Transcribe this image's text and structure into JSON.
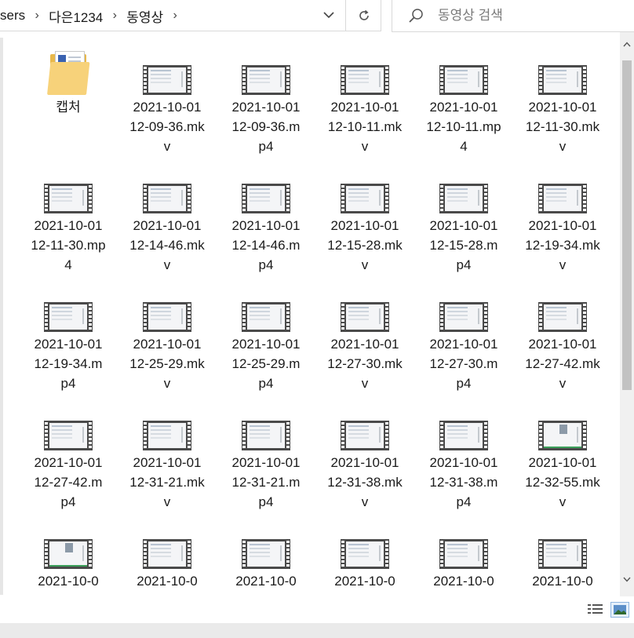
{
  "address": {
    "crumbs": [
      "sers",
      "다은1234",
      "동영상"
    ],
    "separator": "›"
  },
  "search": {
    "placeholder": "동영상 검색",
    "value": ""
  },
  "items": [
    {
      "name": "캡처",
      "type": "folder"
    },
    {
      "name": "2021-10-01 12-09-36.mkv",
      "type": "video"
    },
    {
      "name": "2021-10-01 12-09-36.mp4",
      "type": "video"
    },
    {
      "name": "2021-10-01 12-10-11.mkv",
      "type": "video"
    },
    {
      "name": "2021-10-01 12-10-11.mp4",
      "type": "video"
    },
    {
      "name": "2021-10-01 12-11-30.mkv",
      "type": "video"
    },
    {
      "name": "2021-10-01 12-11-30.mp4",
      "type": "video"
    },
    {
      "name": "2021-10-01 12-14-46.mkv",
      "type": "video"
    },
    {
      "name": "2021-10-01 12-14-46.mp4",
      "type": "video"
    },
    {
      "name": "2021-10-01 12-15-28.mkv",
      "type": "video"
    },
    {
      "name": "2021-10-01 12-15-28.mp4",
      "type": "video"
    },
    {
      "name": "2021-10-01 12-19-34.mkv",
      "type": "video"
    },
    {
      "name": "2021-10-01 12-19-34.mp4",
      "type": "video"
    },
    {
      "name": "2021-10-01 12-25-29.mkv",
      "type": "video"
    },
    {
      "name": "2021-10-01 12-25-29.mp4",
      "type": "video"
    },
    {
      "name": "2021-10-01 12-27-30.mkv",
      "type": "video"
    },
    {
      "name": "2021-10-01 12-27-30.mp4",
      "type": "video"
    },
    {
      "name": "2021-10-01 12-27-42.mkv",
      "type": "video"
    },
    {
      "name": "2021-10-01 12-27-42.mp4",
      "type": "video"
    },
    {
      "name": "2021-10-01 12-31-21.mkv",
      "type": "video"
    },
    {
      "name": "2021-10-01 12-31-21.mp4",
      "type": "video"
    },
    {
      "name": "2021-10-01 12-31-38.mkv",
      "type": "video"
    },
    {
      "name": "2021-10-01 12-31-38.mp4",
      "type": "video"
    },
    {
      "name": "2021-10-01 12-32-55.mkv",
      "type": "video",
      "thumb": "person"
    },
    {
      "name": "2021-10-0",
      "type": "video",
      "thumb": "person"
    },
    {
      "name": "2021-10-0",
      "type": "video"
    },
    {
      "name": "2021-10-0",
      "type": "video"
    },
    {
      "name": "2021-10-0",
      "type": "video"
    },
    {
      "name": "2021-10-0",
      "type": "video"
    },
    {
      "name": "2021-10-0",
      "type": "video"
    }
  ],
  "icons": {
    "dropdown": "chevron-down-icon",
    "refresh": "refresh-icon",
    "search": "search-icon",
    "view_details": "details-view-icon",
    "view_large": "large-icons-view-icon"
  }
}
